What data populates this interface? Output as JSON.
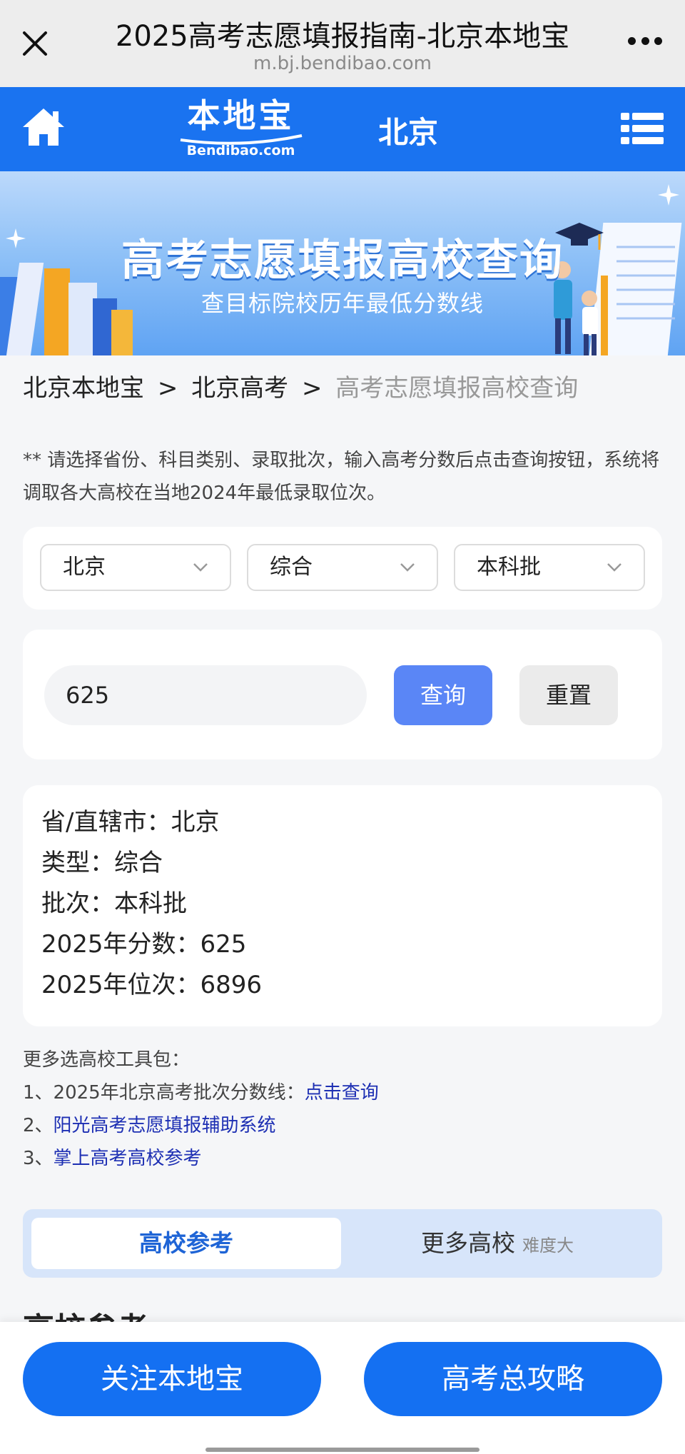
{
  "topbar": {
    "title": "2025高考志愿填报指南-北京本地宝",
    "url": "m.bj.bendibao.com",
    "close_icon": "close-icon",
    "more_icon": "more-dots-icon"
  },
  "header": {
    "logo_cn": "本地宝",
    "logo_en": "Bendibao.com",
    "city": "北京",
    "home_icon": "home-icon",
    "menu_icon": "list-menu-icon",
    "accent_color": "#1a73f0"
  },
  "banner": {
    "title": "高考志愿填报高校查询",
    "subtitle": "查目标院校历年最低分数线"
  },
  "breadcrumb": {
    "items": [
      "北京本地宝",
      "北京高考"
    ],
    "separator": ">",
    "current": "高考志愿填报高校查询"
  },
  "notice": "** 请选择省份、科目类别、录取批次，输入高考分数后点击查询按钮，系统将调取各大高校在当地2024年最低录取位次。",
  "selectors": {
    "province": "北京",
    "subject": "综合",
    "batch": "本科批"
  },
  "query": {
    "score_value": "625",
    "query_label": "查询",
    "reset_label": "重置",
    "query_color": "#5a86f6"
  },
  "result": {
    "province": "省/直辖市：北京",
    "type": "类型：综合",
    "batch": "批次：本科批",
    "score": "2025年分数：625",
    "rank": "2025年位次：6896"
  },
  "tools": {
    "heading": "更多选高校工具包：",
    "item1_prefix": "1、2025年北京高考批次分数线：",
    "item1_link": "点击查询",
    "item2_prefix": "2、",
    "item2_link": "阳光高考志愿填报辅助系统",
    "item3_prefix": "3、",
    "item3_link": "掌上高考高校参考"
  },
  "tabs": {
    "active": "高校参考",
    "more": "更多高校",
    "more_hint": "难度大"
  },
  "section_peek": "高校参考",
  "bottom": {
    "follow_label": "关注本地宝",
    "guide_label": "高考总攻略",
    "button_color": "#1470f2"
  }
}
